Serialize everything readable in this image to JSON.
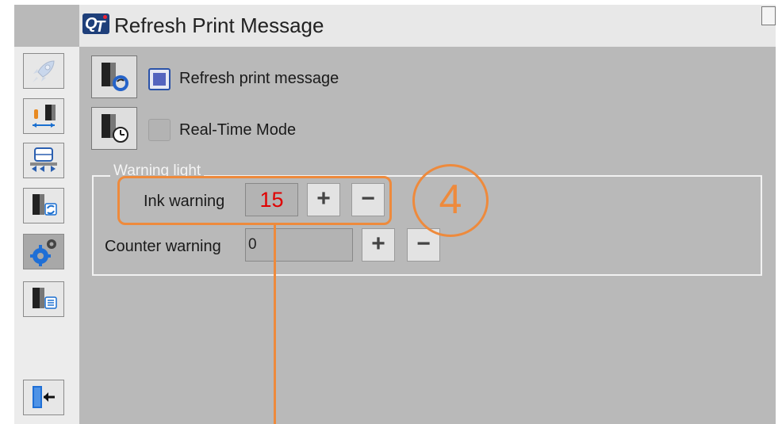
{
  "app": {
    "title": "Refresh Print Message",
    "logo_text": "QT"
  },
  "sidebar": {
    "items": [
      {
        "name": "rocket-icon"
      },
      {
        "name": "printhead-distance-icon"
      },
      {
        "name": "conveyor-icon"
      },
      {
        "name": "refresh-printer-icon"
      },
      {
        "name": "settings-gear-icon",
        "active": true
      },
      {
        "name": "printer-settings-icon"
      },
      {
        "name": "exit-icon"
      }
    ]
  },
  "main": {
    "refresh_print_message": {
      "label": "Refresh print message",
      "checked": true
    },
    "real_time_mode": {
      "label": "Real-Time Mode",
      "checked": false
    },
    "warning_light": {
      "legend": "Warning light",
      "ink_warning": {
        "label": "Ink warning",
        "value": "15",
        "plus": "+",
        "minus": "−"
      },
      "counter_warning": {
        "label": "Counter warning",
        "value": "0",
        "plus": "+",
        "minus": "−"
      }
    }
  },
  "annotation": {
    "number": "4",
    "color": "#ee8a3c"
  }
}
